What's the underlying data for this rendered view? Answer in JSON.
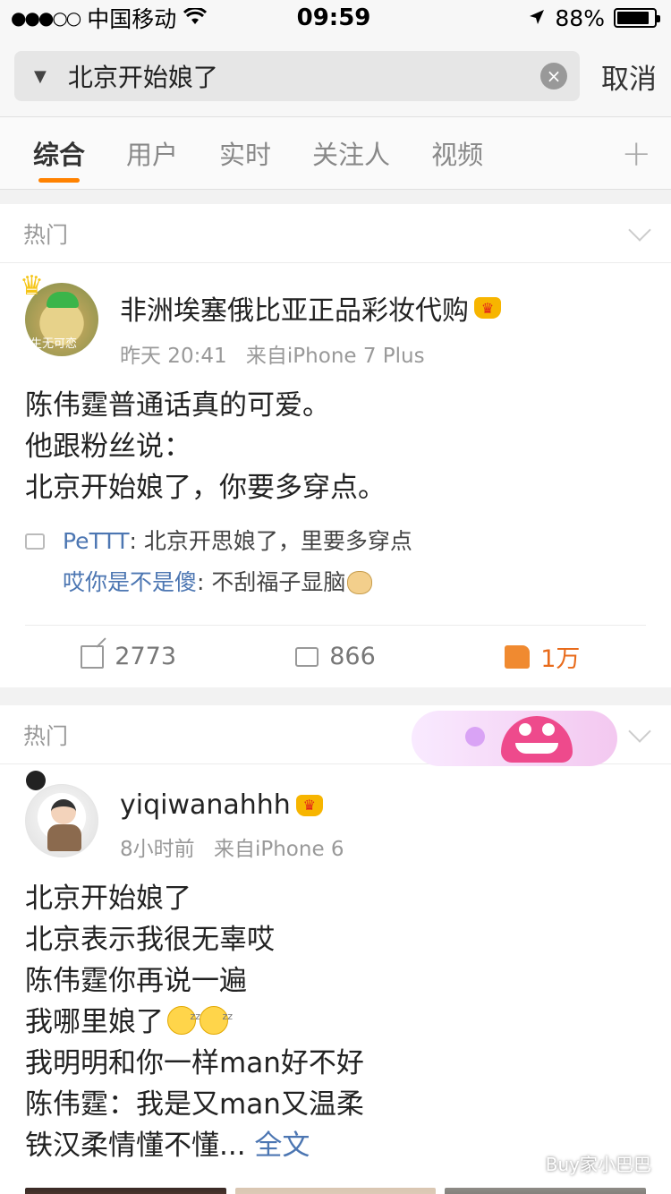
{
  "status_bar": {
    "signal": "●●●○○",
    "carrier": "中国移动",
    "wifi": "wifi-icon",
    "time": "09:59",
    "location": "location-arrow-icon",
    "battery_text": "88%",
    "battery_level": 0.88
  },
  "search": {
    "query": "北京开始娘了",
    "cancel_label": "取消"
  },
  "tabs": [
    {
      "label": "综合",
      "active": true
    },
    {
      "label": "用户",
      "active": false
    },
    {
      "label": "实时",
      "active": false
    },
    {
      "label": "关注人",
      "active": false
    },
    {
      "label": "视频",
      "active": false
    }
  ],
  "tabs_more": "+",
  "posts": [
    {
      "section_label": "热门",
      "user": "非洲埃塞俄比亚正品彩妆代购",
      "avatar_text": "生无可恋",
      "time": "昨天 20:41",
      "source": "来自iPhone 7 Plus",
      "body": [
        "陈伟霆普通话真的可爱。",
        "他跟粉丝说：",
        "北京开始娘了，你要多穿点。"
      ],
      "comments": [
        {
          "user": "PeTTT",
          "text": ": 北京开思娘了，里要多穿点"
        },
        {
          "user": "哎你是不是傻",
          "text": ": 不刮福子显脑"
        }
      ],
      "reposts": "2773",
      "comment_count": "866",
      "likes": "1万"
    },
    {
      "section_label": "热门",
      "user": "yiqiwanahhh",
      "time": "8小时前",
      "source": "来自iPhone 6",
      "body": [
        "北京开始娘了",
        "北京表示我很无辜哎",
        "陈伟霆你再说一遍",
        "我哪里娘了",
        "我明明和你一样man好不好",
        "陈伟霆：我是又man又温柔",
        "铁汉柔情懂不懂..."
      ],
      "full_text_link": "全文"
    }
  ],
  "watermark": "Buy家小巴巴",
  "colors": {
    "accent": "#ff8200",
    "link": "#4c76b2",
    "like": "#e86b1b"
  }
}
